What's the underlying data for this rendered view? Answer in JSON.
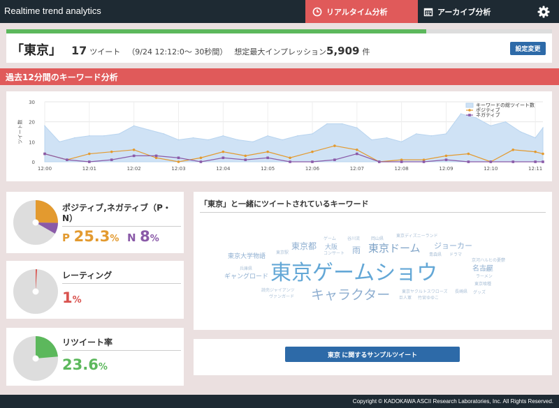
{
  "header": {
    "brand": "Realtime trend analytics",
    "tab_realtime": "リアルタイム分析",
    "tab_archive": "アーカイブ分析"
  },
  "summary": {
    "keyword": "「東京」",
    "tweet_count": "17",
    "tweet_unit": "ツイート",
    "range": "（9/24 12:12:0〜 30秒間）",
    "impression_label": "想定最大インプレッション",
    "impression_value": "5,909",
    "impression_unit": "件",
    "settings_button": "設定変更",
    "progress_fraction": 0.77
  },
  "section": {
    "title": "過去12分間のキーワード分析"
  },
  "chart_data": {
    "type": "line",
    "ylabel": "ツイート数",
    "ylim": [
      0,
      30
    ],
    "yticks": [
      0,
      10,
      20,
      30
    ],
    "xticks": [
      "12:00",
      "12:01",
      "12:02",
      "12:03",
      "12:04",
      "12:05",
      "12:06",
      "12:07",
      "12:08",
      "12:09",
      "12:10",
      "12:11"
    ],
    "legend_position": "top-right",
    "grid": true,
    "series": [
      {
        "name": "キーワードの総ツイート数",
        "type": "area",
        "color": "#cfe2f5",
        "x": [
          0,
          0.33,
          0.67,
          1,
          1.33,
          1.67,
          2,
          2.33,
          2.67,
          3,
          3.33,
          3.67,
          4,
          4.33,
          4.67,
          5,
          5.33,
          5.67,
          6,
          6.33,
          6.67,
          7,
          7.33,
          7.67,
          8,
          8.33,
          8.67,
          9,
          9.33,
          9.67,
          10,
          10.33,
          10.67,
          11,
          11.17
        ],
        "values": [
          18,
          10,
          12,
          13,
          13,
          14,
          18,
          16,
          14,
          11,
          12,
          11,
          13,
          11,
          10,
          13,
          11,
          13,
          14,
          19,
          19,
          17,
          11,
          12,
          10,
          14,
          13,
          14,
          24,
          22,
          18,
          20,
          15,
          12,
          17
        ]
      },
      {
        "name": "ポジティブ",
        "color": "#e39a2f",
        "x": [
          0,
          0.5,
          1,
          1.5,
          2,
          2.5,
          3,
          3.5,
          4,
          4.5,
          5,
          5.5,
          6,
          6.5,
          7,
          7.5,
          8,
          8.5,
          9,
          9.5,
          10,
          10.5,
          11,
          11.17
        ],
        "values": [
          4,
          1,
          4,
          5,
          6,
          2,
          0,
          2,
          5,
          3,
          5,
          2,
          5,
          8,
          6,
          0,
          1,
          1,
          3,
          4,
          0,
          6,
          5,
          4
        ]
      },
      {
        "name": "ネガティブ",
        "color": "#8a5aa8",
        "x": [
          0,
          0.5,
          1,
          1.5,
          2,
          2.5,
          3,
          3.5,
          4,
          4.5,
          5,
          5.5,
          6,
          6.5,
          7,
          7.5,
          8,
          8.5,
          9,
          9.5,
          10,
          10.5,
          11,
          11.17
        ],
        "values": [
          4,
          1,
          0,
          1,
          3,
          3,
          2,
          0,
          2,
          1,
          2,
          0,
          0,
          1,
          4,
          0,
          0,
          0,
          1,
          0,
          0,
          0,
          0,
          0
        ]
      }
    ]
  },
  "cards": {
    "pn_title": "ポジティブ,ネガティブ（P・N）",
    "pn_p_letter": "P",
    "pn_p_value": "25.3",
    "pn_p_unit": "%",
    "pn_n_letter": "N",
    "pn_n_value": "8",
    "pn_n_unit": "%",
    "pn_positive_fraction": 0.253,
    "pn_negative_fraction": 0.08,
    "rating_title": "レーティング",
    "rating_value": "1",
    "rating_unit": "%",
    "rating_fraction": 0.01,
    "retweet_title": "リツイート率",
    "retweet_value": "23.6",
    "retweet_unit": "%",
    "retweet_fraction": 0.236,
    "colors": {
      "positive": "#e39a2f",
      "negative": "#8a5aa8",
      "rating": "#d9534f",
      "retweet": "#5cb85c",
      "rest": "#dddddd"
    }
  },
  "cloud": {
    "title": "「東京」と一緒にツイートされているキーワード",
    "words": [
      {
        "text": "東京ゲームショウ",
        "size": 30
      },
      {
        "text": "キャラクター",
        "size": 19
      },
      {
        "text": "東京ドーム",
        "size": 15
      },
      {
        "text": "東京都",
        "size": 12
      },
      {
        "text": "ジョーカー",
        "size": 11
      },
      {
        "text": "大阪",
        "size": 9
      },
      {
        "text": "雨",
        "size": 12
      },
      {
        "text": "名古屋",
        "size": 10
      },
      {
        "text": "東京大学物語",
        "size": 9
      },
      {
        "text": "ギャングロード",
        "size": 9
      },
      {
        "text": "ゲーム",
        "size": 6
      },
      {
        "text": "谷川流",
        "size": 6
      },
      {
        "text": "岡山県",
        "size": 6
      },
      {
        "text": "東京ディズニーランド",
        "size": 6
      },
      {
        "text": "東京駅",
        "size": 6
      },
      {
        "text": "コンサート",
        "size": 6
      },
      {
        "text": "青森県",
        "size": 6
      },
      {
        "text": "ドラマ",
        "size": 6
      },
      {
        "text": "京河ハルヒの憂鬱",
        "size": 6
      },
      {
        "text": "兵庫県",
        "size": 6
      },
      {
        "text": "千葉",
        "size": 6
      },
      {
        "text": "ラーメン",
        "size": 6
      },
      {
        "text": "東京喰種",
        "size": 6
      },
      {
        "text": "読売ジャイアンツ",
        "size": 6
      },
      {
        "text": "ヴァンガード",
        "size": 6
      },
      {
        "text": "東京ヤクルトスワローズ",
        "size": 6
      },
      {
        "text": "長崎県",
        "size": 6
      },
      {
        "text": "巨人軍",
        "size": 6
      },
      {
        "text": "竹宮ゆゆこ",
        "size": 6
      },
      {
        "text": "グッズ",
        "size": 6
      }
    ]
  },
  "sample": {
    "button": "東京 に関するサンプルツイート"
  },
  "footer": {
    "copyright": "Copyright © KADOKAWA ASCII Research Laboratories, Inc. All Rights Reserved."
  }
}
